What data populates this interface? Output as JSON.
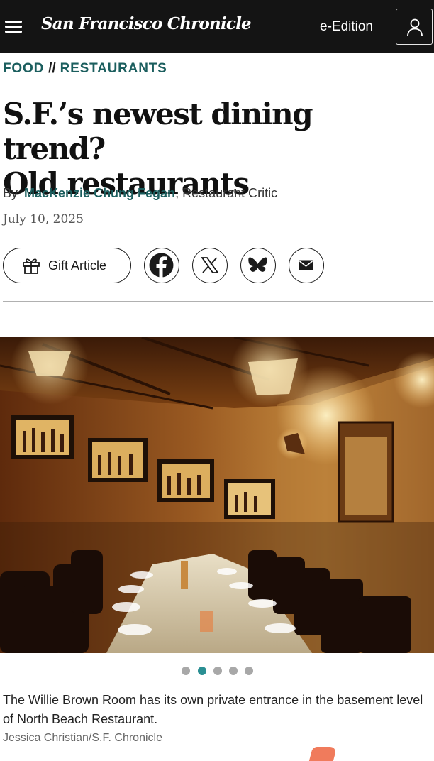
{
  "header": {
    "masthead": "San Francisco Chronicle",
    "eedition_label": "e-Edition"
  },
  "section": {
    "primary": "FOOD",
    "separator": "//",
    "secondary": "RESTAURANTS"
  },
  "article": {
    "headline_line1": "S.F.’s newest dining trend?",
    "headline_line2": "Old restaurants",
    "by": "By",
    "author": "MacKenzie Chung Fegan",
    "role": ",  Restaurant Critic",
    "date": "July 10, 2025"
  },
  "actions": {
    "gift_label": "Gift Article",
    "share_icons": [
      "facebook-icon",
      "x-icon",
      "bluesky-icon",
      "mail-icon"
    ]
  },
  "gallery": {
    "slide_count": 5,
    "active_slide": 2,
    "caption": "The Willie Brown Room has its own private entrance in the basement level of North Beach Restaurant.",
    "credit": "Jessica Christian/S.F. Chronicle"
  },
  "colors": {
    "topbar": "#141414",
    "accent_teal": "#1b5e5e",
    "active_dot": "#2a8f93",
    "inactive_dot": "#a8a8a8"
  }
}
